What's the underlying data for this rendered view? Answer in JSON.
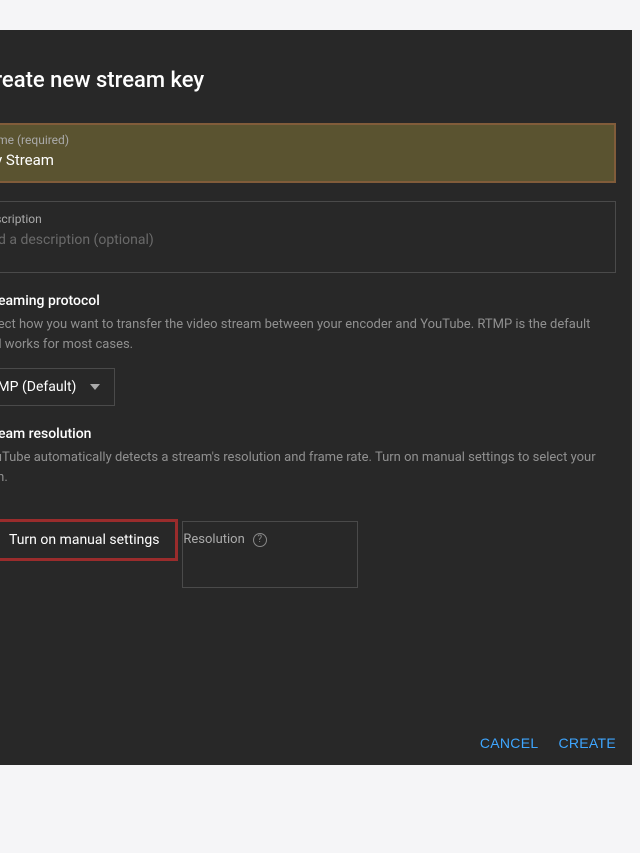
{
  "dialog": {
    "title": "Create new stream key",
    "name_field": {
      "label": "Name (required)",
      "value": "My Stream"
    },
    "desc_field": {
      "label": "Description",
      "placeholder": "Add a description (optional)"
    },
    "protocol": {
      "title": "Streaming protocol",
      "desc": "Select how you want to transfer the video stream between your encoder and YouTube. RTMP is the default and works for most cases.",
      "selected": "RTMP (Default)"
    },
    "resolution": {
      "title": "Stream resolution",
      "desc": "YouTube automatically detects a stream's resolution and frame rate. Turn on manual settings to select your own.",
      "checkbox_label": "Turn on manual settings",
      "dropdown_label": "Resolution"
    },
    "footer": {
      "cancel": "CANCEL",
      "create": "CREATE"
    }
  }
}
